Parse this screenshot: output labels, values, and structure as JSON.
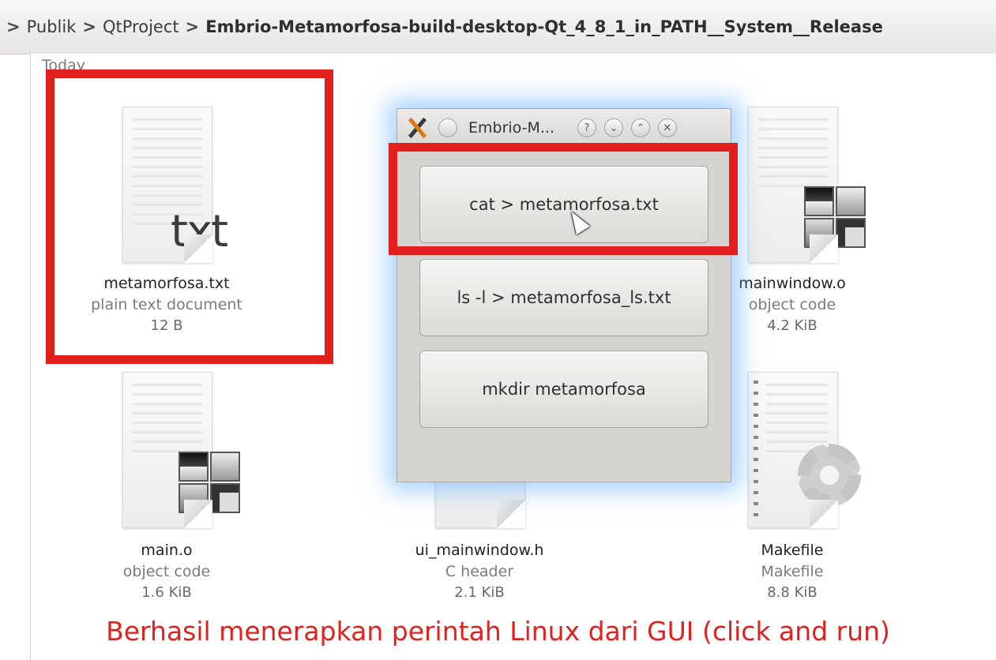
{
  "breadcrumb": {
    "items": [
      "Publik",
      "QtProject"
    ],
    "current": "Embrio-Metamorfosa-build-desktop-Qt_4_8_1_in_PATH__System__Release",
    "separator": ">"
  },
  "view": {
    "group_title": "Today"
  },
  "files": [
    {
      "name": "metamorfosa.txt",
      "type": "plain text document",
      "size": "12 B",
      "icon_text": "txt"
    },
    {
      "name": "mainwindow.o",
      "type": "object code",
      "size": "4.2 KiB"
    },
    {
      "name": "main.o",
      "type": "object code",
      "size": "1.6 KiB"
    },
    {
      "name": "ui_mainwindow.h",
      "type": "C header",
      "size": "2.1 KiB"
    },
    {
      "name": "Makefile",
      "type": "Makefile",
      "size": "8.8 KiB"
    }
  ],
  "dialog": {
    "title": "Embrio-M...",
    "help_glyph": "?",
    "buttons": [
      "cat > metamorfosa.txt",
      "ls -l > metamorfosa_ls.txt",
      "mkdir metamorfosa"
    ]
  },
  "caption": "Berhasil menerapkan perintah Linux dari GUI (click and run)",
  "colors": {
    "highlight": "#e11f1c",
    "glow": "#5aaaff"
  }
}
